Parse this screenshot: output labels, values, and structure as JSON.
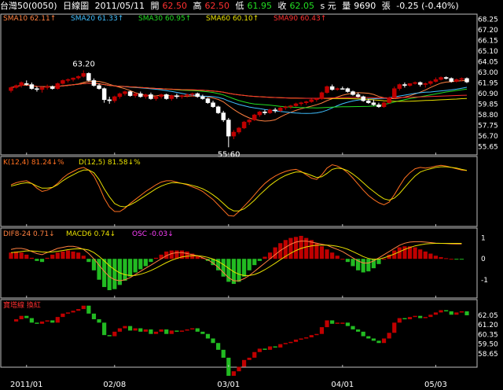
{
  "header": {
    "stock": "台灣50(0050)",
    "period": "日線圖",
    "date": "2011/05/11",
    "open_label": "開",
    "open": "62.50",
    "high_label": "高",
    "high": "62.50",
    "low_label": "低",
    "low": "61.95",
    "close_label": "收",
    "close": "62.05",
    "unit": "s 元",
    "volume_label": "量",
    "volume": "9690",
    "volume_unit": "張",
    "change": "-0.25 (-0.40%)"
  },
  "colors": {
    "up": "#c00000",
    "down": "#22bb22",
    "flat": "#ffffff",
    "sma10": "#ff8040",
    "sma20": "#3fbfff",
    "sma30": "#22dd22",
    "sma60": "#e8e000",
    "sma90": "#ff3030",
    "k": "#ff7020",
    "d": "#e8e000",
    "dif": "#ff8040",
    "macd": "#e8e000",
    "osc": "#ff40ff",
    "frame": "#bfbfbf"
  },
  "chart_data": [
    {
      "type": "candlestick",
      "panel": "price",
      "legend": [
        {
          "name": "SMA10",
          "value": "62.11",
          "arrow": "up"
        },
        {
          "name": "SMA20",
          "value": "61.33",
          "arrow": "up"
        },
        {
          "name": "SMA30",
          "value": "60.95",
          "arrow": "up"
        },
        {
          "name": "SMA60",
          "value": "60.10",
          "arrow": "up"
        },
        {
          "name": "SMA90",
          "value": "60.43",
          "arrow": "up"
        }
      ],
      "y_ticks": [
        "68.25",
        "67.20",
        "66.15",
        "65.10",
        "64.05",
        "63.00",
        "61.95",
        "60.90",
        "59.85",
        "58.80",
        "57.75",
        "56.70",
        "55.65"
      ],
      "ylim": [
        55.0,
        68.6
      ],
      "x_ticks": [
        "2011/01",
        "02/08",
        "03/01",
        "04/01",
        "05/03"
      ],
      "annotations": [
        {
          "text": "63.20"
        },
        {
          "text": "55.60"
        }
      ],
      "candles": [
        [
          61.2,
          61.6,
          61.0,
          61.5
        ],
        [
          61.5,
          61.8,
          61.4,
          61.7
        ],
        [
          61.7,
          62.1,
          61.5,
          62.0
        ],
        [
          61.9,
          62.2,
          61.7,
          61.8
        ],
        [
          61.8,
          62.0,
          61.3,
          61.4
        ],
        [
          61.4,
          61.6,
          61.1,
          61.3
        ],
        [
          61.3,
          61.6,
          61.0,
          61.5
        ],
        [
          61.5,
          61.8,
          61.3,
          61.6
        ],
        [
          61.6,
          61.7,
          61.3,
          61.4
        ],
        [
          61.4,
          62.0,
          61.3,
          61.9
        ],
        [
          61.9,
          62.3,
          61.8,
          62.2
        ],
        [
          62.2,
          62.4,
          62.0,
          62.3
        ],
        [
          62.3,
          62.5,
          62.1,
          62.45
        ],
        [
          62.45,
          62.7,
          62.3,
          62.6
        ],
        [
          62.6,
          63.2,
          62.5,
          62.9
        ],
        [
          62.9,
          63.0,
          62.1,
          62.2
        ],
        [
          62.2,
          62.4,
          61.6,
          61.7
        ],
        [
          61.7,
          61.9,
          61.3,
          61.4
        ],
        [
          61.4,
          61.5,
          60.0,
          60.3
        ],
        [
          60.3,
          60.6,
          59.9,
          60.2
        ],
        [
          60.2,
          60.7,
          60.0,
          60.6
        ],
        [
          60.6,
          61.0,
          60.4,
          60.9
        ],
        [
          60.9,
          61.2,
          60.7,
          61.1
        ],
        [
          61.1,
          61.2,
          60.6,
          60.7
        ],
        [
          60.7,
          61.0,
          60.5,
          60.9
        ],
        [
          60.9,
          61.1,
          60.5,
          60.6
        ],
        [
          60.6,
          60.9,
          60.4,
          60.8
        ],
        [
          60.8,
          61.0,
          60.3,
          60.4
        ],
        [
          60.4,
          60.7,
          60.2,
          60.6
        ],
        [
          60.6,
          60.9,
          60.4,
          60.8
        ],
        [
          60.8,
          60.9,
          60.3,
          60.4
        ],
        [
          60.4,
          60.8,
          60.2,
          60.7
        ],
        [
          60.7,
          60.9,
          60.4,
          60.6
        ],
        [
          60.6,
          60.8,
          60.4,
          60.7
        ],
        [
          60.7,
          60.9,
          60.5,
          60.8
        ],
        [
          60.8,
          61.0,
          60.6,
          60.9
        ],
        [
          60.9,
          61.0,
          60.5,
          60.6
        ],
        [
          60.6,
          60.8,
          60.3,
          60.4
        ],
        [
          60.4,
          60.5,
          59.9,
          60.0
        ],
        [
          60.0,
          60.2,
          59.5,
          59.6
        ],
        [
          59.6,
          59.7,
          58.9,
          59.0
        ],
        [
          59.0,
          59.2,
          58.1,
          58.3
        ],
        [
          58.3,
          58.5,
          55.6,
          56.7
        ],
        [
          56.7,
          57.3,
          56.4,
          57.1
        ],
        [
          57.1,
          57.6,
          56.9,
          57.5
        ],
        [
          57.5,
          58.2,
          57.4,
          58.1
        ],
        [
          58.1,
          58.4,
          57.8,
          58.3
        ],
        [
          58.3,
          58.9,
          58.2,
          58.8
        ],
        [
          58.8,
          59.2,
          58.6,
          59.1
        ],
        [
          59.1,
          59.3,
          58.8,
          59.0
        ],
        [
          59.0,
          59.4,
          58.9,
          59.3
        ],
        [
          59.3,
          59.5,
          59.0,
          59.2
        ],
        [
          59.2,
          59.6,
          59.1,
          59.5
        ],
        [
          59.5,
          59.7,
          59.3,
          59.6
        ],
        [
          59.6,
          59.8,
          59.4,
          59.7
        ],
        [
          59.7,
          60.0,
          59.6,
          59.9
        ],
        [
          59.9,
          60.1,
          59.7,
          60.0
        ],
        [
          60.0,
          60.2,
          59.8,
          60.1
        ],
        [
          60.1,
          60.4,
          60.0,
          60.3
        ],
        [
          60.3,
          60.5,
          60.1,
          60.4
        ],
        [
          60.4,
          61.1,
          60.3,
          61.0
        ],
        [
          61.0,
          61.7,
          60.9,
          61.6
        ],
        [
          61.6,
          61.8,
          61.2,
          61.3
        ],
        [
          61.3,
          61.5,
          61.2,
          61.4
        ],
        [
          61.4,
          61.6,
          61.35,
          61.4
        ],
        [
          61.4,
          61.5,
          61.0,
          61.1
        ],
        [
          61.1,
          61.2,
          60.7,
          60.8
        ],
        [
          60.8,
          61.0,
          60.5,
          60.6
        ],
        [
          60.6,
          60.7,
          60.1,
          60.2
        ],
        [
          60.2,
          60.4,
          59.9,
          60.0
        ],
        [
          60.0,
          60.3,
          59.7,
          59.8
        ],
        [
          59.8,
          60.0,
          59.5,
          59.6
        ],
        [
          59.6,
          60.1,
          59.5,
          60.0
        ],
        [
          60.0,
          60.6,
          59.9,
          60.5
        ],
        [
          60.5,
          61.6,
          60.4,
          61.4
        ],
        [
          61.4,
          61.9,
          61.2,
          61.8
        ],
        [
          61.8,
          62.0,
          61.5,
          61.7
        ],
        [
          61.7,
          61.9,
          61.6,
          61.9
        ],
        [
          61.9,
          62.1,
          61.8,
          62.0
        ],
        [
          62.0,
          62.1,
          61.6,
          61.8
        ],
        [
          61.8,
          62.0,
          61.5,
          61.9
        ],
        [
          61.9,
          62.2,
          61.7,
          62.1
        ],
        [
          62.1,
          62.5,
          62.0,
          62.3
        ],
        [
          62.3,
          62.6,
          62.2,
          62.5
        ],
        [
          62.5,
          62.6,
          62.3,
          62.4
        ],
        [
          62.4,
          62.5,
          62.0,
          62.1
        ],
        [
          62.1,
          62.4,
          62.0,
          62.3
        ],
        [
          62.3,
          62.5,
          62.1,
          62.4
        ],
        [
          62.4,
          62.5,
          61.95,
          62.05
        ]
      ]
    },
    {
      "type": "line",
      "panel": "kd",
      "legend": [
        {
          "name": "K(12,4)",
          "value": "81.24",
          "arrow": "down",
          "suffix": "%"
        },
        {
          "name": "D(12,5)",
          "value": "81.58",
          "arrow": "down",
          "suffix": "%"
        }
      ],
      "ylim": [
        0,
        100
      ],
      "series": [
        {
          "name": "K(12,4)",
          "values": [
            60,
            63,
            65,
            66,
            62,
            55,
            50,
            52,
            56,
            62,
            70,
            76,
            80,
            84,
            86,
            82,
            73,
            58,
            40,
            27,
            20,
            20,
            25,
            32,
            38,
            44,
            50,
            55,
            60,
            64,
            66,
            66,
            64,
            62,
            60,
            57,
            54,
            50,
            44,
            38,
            30,
            22,
            14,
            13,
            20,
            28,
            36,
            45,
            54,
            62,
            68,
            73,
            77,
            80,
            82,
            83,
            80,
            75,
            70,
            68,
            75,
            85,
            90,
            88,
            84,
            78,
            70,
            61,
            52,
            44,
            38,
            33,
            30,
            34,
            45,
            58,
            70,
            78,
            84,
            86,
            85,
            86,
            88,
            89,
            88,
            86,
            84,
            82,
            81.24
          ]
        },
        {
          "name": "D(12,5)",
          "values": [
            58,
            60,
            62,
            63,
            62,
            58,
            55,
            55,
            56,
            60,
            66,
            71,
            75,
            79,
            82,
            82,
            78,
            68,
            54,
            42,
            32,
            28,
            27,
            30,
            34,
            39,
            44,
            49,
            54,
            58,
            61,
            63,
            63,
            62,
            61,
            59,
            57,
            54,
            50,
            45,
            39,
            32,
            25,
            21,
            21,
            24,
            30,
            37,
            45,
            52,
            59,
            65,
            70,
            74,
            77,
            79,
            79,
            77,
            74,
            71,
            72,
            77,
            83,
            85,
            84,
            81,
            76,
            70,
            63,
            56,
            50,
            44,
            39,
            37,
            40,
            47,
            56,
            65,
            73,
            79,
            82,
            84,
            86,
            87,
            87,
            86,
            85,
            83,
            81.58
          ]
        }
      ]
    },
    {
      "type": "bar+line",
      "panel": "macd",
      "legend": [
        {
          "name": "DIF8-24",
          "value": "0.71",
          "arrow": "down"
        },
        {
          "name": "MACD6",
          "value": "0.74",
          "arrow": "down"
        },
        {
          "name": "OSC",
          "value": "-0.03",
          "arrow": "down"
        }
      ],
      "y_ticks": [
        "1",
        "0",
        "-1"
      ],
      "ylim": [
        -1.8,
        1.4
      ],
      "series": [
        {
          "name": "OSC",
          "values": [
            0.3,
            0.35,
            0.3,
            0.2,
            0.05,
            -0.1,
            -0.15,
            0.05,
            0.2,
            0.3,
            0.35,
            0.4,
            0.35,
            0.3,
            0.15,
            -0.15,
            -0.55,
            -1.0,
            -1.35,
            -1.5,
            -1.45,
            -1.25,
            -1.05,
            -0.85,
            -0.65,
            -0.5,
            -0.35,
            -0.15,
            0.05,
            0.2,
            0.35,
            0.4,
            0.4,
            0.4,
            0.35,
            0.25,
            0.15,
            0.05,
            -0.1,
            -0.3,
            -0.55,
            -0.85,
            -1.1,
            -1.2,
            -1.1,
            -0.85,
            -0.55,
            -0.3,
            -0.1,
            0.1,
            0.3,
            0.55,
            0.75,
            0.9,
            1.0,
            1.05,
            1.1,
            1.0,
            0.9,
            0.75,
            0.6,
            0.45,
            0.3,
            0.15,
            0.0,
            -0.15,
            -0.35,
            -0.55,
            -0.65,
            -0.6,
            -0.45,
            -0.25,
            0.0,
            0.2,
            0.4,
            0.55,
            0.6,
            0.6,
            0.55,
            0.45,
            0.35,
            0.25,
            0.15,
            0.08,
            0.03,
            0.0,
            -0.02,
            -0.03
          ]
        },
        {
          "name": "DIF8-24",
          "values": [
            0.45,
            0.5,
            0.5,
            0.45,
            0.35,
            0.25,
            0.2,
            0.3,
            0.4,
            0.5,
            0.55,
            0.6,
            0.6,
            0.55,
            0.45,
            0.25,
            0.0,
            -0.3,
            -0.6,
            -0.85,
            -1.0,
            -1.05,
            -1.0,
            -0.9,
            -0.75,
            -0.6,
            -0.45,
            -0.3,
            -0.15,
            0.0,
            0.15,
            0.25,
            0.3,
            0.3,
            0.25,
            0.2,
            0.15,
            0.05,
            -0.05,
            -0.2,
            -0.4,
            -0.65,
            -0.9,
            -1.05,
            -1.05,
            -0.95,
            -0.8,
            -0.6,
            -0.4,
            -0.2,
            0.0,
            0.2,
            0.4,
            0.55,
            0.7,
            0.8,
            0.85,
            0.85,
            0.8,
            0.75,
            0.7,
            0.65,
            0.55,
            0.45,
            0.35,
            0.2,
            0.05,
            -0.1,
            -0.2,
            -0.2,
            -0.1,
            0.05,
            0.2,
            0.35,
            0.5,
            0.65,
            0.75,
            0.8,
            0.82,
            0.82,
            0.8,
            0.78,
            0.75,
            0.74,
            0.73,
            0.72,
            0.71,
            0.71
          ]
        },
        {
          "name": "MACD6",
          "values": [
            0.3,
            0.32,
            0.35,
            0.38,
            0.38,
            0.36,
            0.33,
            0.32,
            0.33,
            0.36,
            0.4,
            0.44,
            0.47,
            0.48,
            0.47,
            0.42,
            0.3,
            0.12,
            -0.1,
            -0.33,
            -0.52,
            -0.67,
            -0.76,
            -0.8,
            -0.79,
            -0.74,
            -0.66,
            -0.56,
            -0.44,
            -0.31,
            -0.18,
            -0.07,
            0.02,
            0.09,
            0.13,
            0.15,
            0.15,
            0.12,
            0.07,
            -0.01,
            -0.12,
            -0.27,
            -0.45,
            -0.62,
            -0.74,
            -0.8,
            -0.8,
            -0.75,
            -0.65,
            -0.52,
            -0.37,
            -0.21,
            -0.04,
            0.12,
            0.27,
            0.4,
            0.5,
            0.57,
            0.62,
            0.65,
            0.66,
            0.66,
            0.64,
            0.6,
            0.54,
            0.46,
            0.35,
            0.23,
            0.11,
            0.02,
            -0.02,
            -0.01,
            0.05,
            0.13,
            0.23,
            0.34,
            0.45,
            0.54,
            0.62,
            0.67,
            0.71,
            0.73,
            0.74,
            0.74,
            0.74,
            0.74,
            0.74,
            0.74
          ]
        }
      ]
    },
    {
      "type": "step-bar",
      "panel": "breadth",
      "legend_title": "寶塔線 換紅",
      "y_ticks": [
        "62.05",
        "61.20",
        "60.35",
        "59.50",
        "58.65"
      ],
      "ylim": [
        57.6,
        63.3
      ],
      "source": "close"
    }
  ]
}
